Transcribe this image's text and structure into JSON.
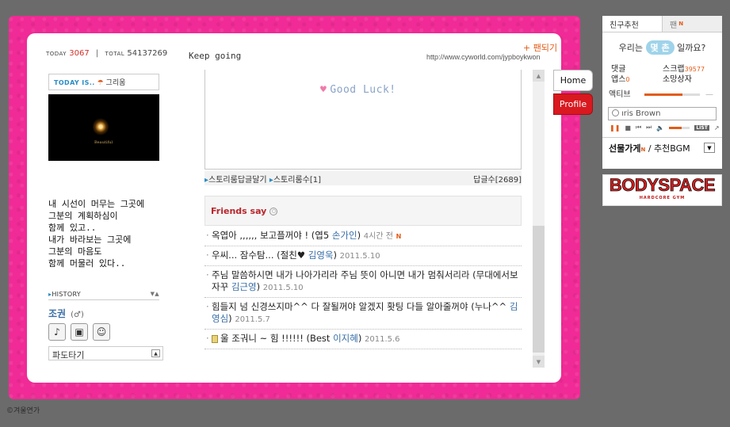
{
  "counter": {
    "today_label": "TODAY",
    "today_value": "3067",
    "separator": "|",
    "total_label": "TOTAL",
    "total_value": "54137269"
  },
  "page_title": "Keep going",
  "fan_link": "+ 팬되기",
  "homepage_url": "http://www.cyworld.com/jypboykwon",
  "left": {
    "today_is_label": "TODAY IS..",
    "mood_icon": "umbrella-icon",
    "mood": "그리움",
    "photo_caption": "Beautiful",
    "diary_text": "내 시선이 머무는 그곳에\n그분의 계획하심이\n함께 있고..\n내가 바라보는 그곳에\n그분의 마음도\n함께 머물러 있다..",
    "history_label": "HISTORY",
    "owner_name": "조권",
    "gender_symbol": "(♂)",
    "icon_buttons": [
      "music-icon",
      "radio-icon",
      "minimi-icon"
    ],
    "pado_label": "파도타기"
  },
  "story": {
    "good_luck": "Good Luck!",
    "reply_link": "스토리룸답글달기",
    "count_link": "스토리룸수[1]",
    "reply_count": "답글수[2689]"
  },
  "friends_say": {
    "title": "Friends say",
    "items": [
      {
        "text": "옥엽아 ,,,,,, 보고플꺼야 ! (엽5 ",
        "who": "손가인",
        "close": ")",
        "date": "4시간 전",
        "is_new": "N",
        "emoticon": false
      },
      {
        "text": "우씨... 잠수탐... (절친♥ ",
        "who": "김영욱",
        "close": ")",
        "date": "2011.5.10",
        "is_new": "",
        "emoticon": false
      },
      {
        "text": "주님 말씀하시면 내가 나아가리라 주님 뜻이 아니면 내가 멈춰서리라 (무대에서보자꾸 ",
        "who": "김근영",
        "close": ")",
        "date": "2011.5.10",
        "is_new": "",
        "emoticon": false
      },
      {
        "text": "힘들지 넘 신경쓰지마^^ 다 잘될꺼야 알겠지 홧팅 다들 알아줄꺼야 (누나^^ ",
        "who": "김영심",
        "close": ")",
        "date": "2011.5.7",
        "is_new": "",
        "emoticon": false
      },
      {
        "text": "울 조궈니 ~ 힘 !!!!!! (Best ",
        "who": "이지혜",
        "close": ")",
        "date": "2011.5.6",
        "is_new": "",
        "emoticon": true
      }
    ]
  },
  "tabs": {
    "home": "Home",
    "profile": "Profile"
  },
  "signature": "©겨울연가",
  "right_panel": {
    "tab_friends": "친구추천",
    "tab_fan": "팬",
    "fan_new": "N",
    "ilchon_prefix": "우리는",
    "ilchon_pill": "몇 촌",
    "ilchon_suffix": "일까요?",
    "stats": [
      {
        "label": "댓글",
        "value": ""
      },
      {
        "label": "스크랩",
        "value": "39577"
      },
      {
        "label": "앱스",
        "value": "0"
      },
      {
        "label": "소망상자",
        "value": ""
      }
    ],
    "active_label": "액티브",
    "active_level": 0.68,
    "active_dash": "—",
    "bgm_title": "ıris Brown",
    "volume_level": 0.6,
    "list_label": "LIST",
    "gift_label": "선물가게",
    "gift_new": "N",
    "bgm_label": "/ 추천BGM"
  },
  "banner": {
    "title": "BODYSPACE",
    "subtitle": "HARDCORE GYM"
  },
  "colors": {
    "frame": "#f02a96",
    "accent": "#e35b18",
    "friends_title": "#b8262c",
    "profile_tab": "#d8191f"
  }
}
